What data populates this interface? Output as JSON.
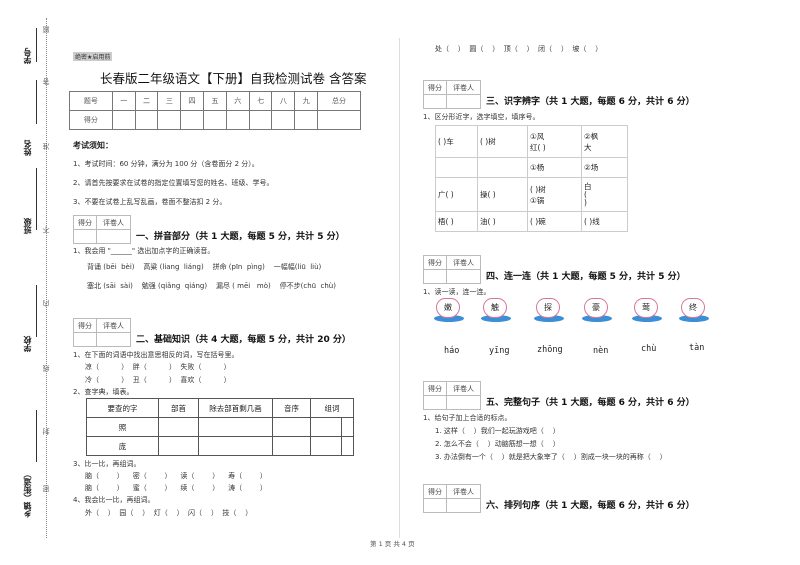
{
  "binding_margin": {
    "labels": [
      "学号",
      "姓名",
      "班级",
      "学校",
      "乡镇（街道）"
    ],
    "seal_chars": [
      "题",
      "答",
      "准",
      "不",
      "内",
      "线",
      "封",
      "密"
    ]
  },
  "header": {
    "secret_tag": "绝密★启用前",
    "title": "长春版二年级语文【下册】自我检测试卷 含答案"
  },
  "score_table": {
    "row1": [
      "题号",
      "一",
      "二",
      "三",
      "四",
      "五",
      "六",
      "七",
      "八",
      "九",
      "总分"
    ],
    "row2_label": "得分"
  },
  "notice": {
    "heading": "考试须知：",
    "items": [
      "1、考试时间：60 分钟，满分为 100 分（含卷面分 2 分）。",
      "2、请首先按要求在试卷的指定位置填写您的姓名、班级、学号。",
      "3、不要在试卷上乱写乱画，卷面不整洁扣 2 分。"
    ]
  },
  "grader": {
    "score": "得分",
    "reviewer": "评卷人"
  },
  "section1": {
    "title": "一、拼音部分（共 1 大题，每题 5 分，共计 5 分）",
    "q1": "1、我会用 \"______\" 选出加点字的正确读音。",
    "line1": "背诵 (bēi  bèi)    高粱 (liang  liáng)    拼命 (pīn  pìng)    一幅幅(liū  liù)",
    "line2": "塞北 (sāi  sài)    勉强 (qiǎng  qiáng)    漏尽 ( mēi   mò)    停不步(chū  chù)"
  },
  "section2": {
    "title": "二、基础知识（共 4 大题，每题 5 分，共计 20 分）",
    "q1": "1、在下面的词语中找出意思相反的词，写在括号里。",
    "q1_line1": "凉（          ）  胖（          ）  失败（          ）",
    "q1_line2": "冷（          ）  丑（          ）  喜欢（          ）",
    "q2": "2、查字典，填表。",
    "dict_headers": [
      "要查的字",
      "部首",
      "除去部首剩几画",
      "音序",
      "组词"
    ],
    "dict_rows": [
      "照",
      "庞"
    ],
    "q3": "3、比一比，再组词。",
    "q3_line1": "脑（        ）    密（        ）    读（        ）    寿（        ）",
    "q3_line2": "脑（        ）    蜜（        ）    续（        ）    涛（        ）",
    "q4": "4、我会比一比，再组词。",
    "q4_line1": "外（    ）  园（    ）  灯（    ）  闪（    ）  技（    ）",
    "q4_line2": "处（    ）  圆（    ）  顶（    ）  闭（    ）  坡（    ）"
  },
  "section3": {
    "title": "三、识字辨字（共 1 大题，每题 6 分，共计 6 分）",
    "q1": "1、区分形近字，选字填空，填序号。",
    "rows": [
      [
        "(       )车",
        "(       )树",
        "①风\n红(       )",
        "②枫\n大"
      ],
      [
        "",
        "",
        "①杨",
        "②场"
      ],
      [
        "广(       )",
        "操(       )",
        "(       )树\n①锅",
        "白\n(\n)"
      ],
      [
        "梧(       )",
        "油(       )",
        "(       )碗",
        "(       )线"
      ]
    ]
  },
  "section4": {
    "title": "四、连一连（共 1 大题，每题 5 分，共计 5 分）",
    "q1": "1、读一读，连一连。",
    "chars": [
      "嫩",
      "触",
      "探",
      "豪",
      "莺",
      "终"
    ],
    "pinyin": [
      "háo",
      "yīng",
      "zhōng",
      "nèn",
      "chù",
      "tàn"
    ]
  },
  "section5": {
    "title": "五、完整句子（共 1 大题，每题 6 分，共计 6 分）",
    "q1": "1、给句子加上合适的标点。",
    "lines": [
      "1. 这样（    ）我们一起玩游戏吧（    ）",
      "2. 怎么不会（    ）动脑筋想一想（    ）",
      "3. 办法倒有一个（    ）就是把大象宰了（    ）割成一块一块的再称（    ）"
    ]
  },
  "section6": {
    "title": "六、排列句序（共 1 大题，每题 6 分，共计 6 分）"
  },
  "footer": {
    "page": "第 1 页 共 4 页"
  }
}
